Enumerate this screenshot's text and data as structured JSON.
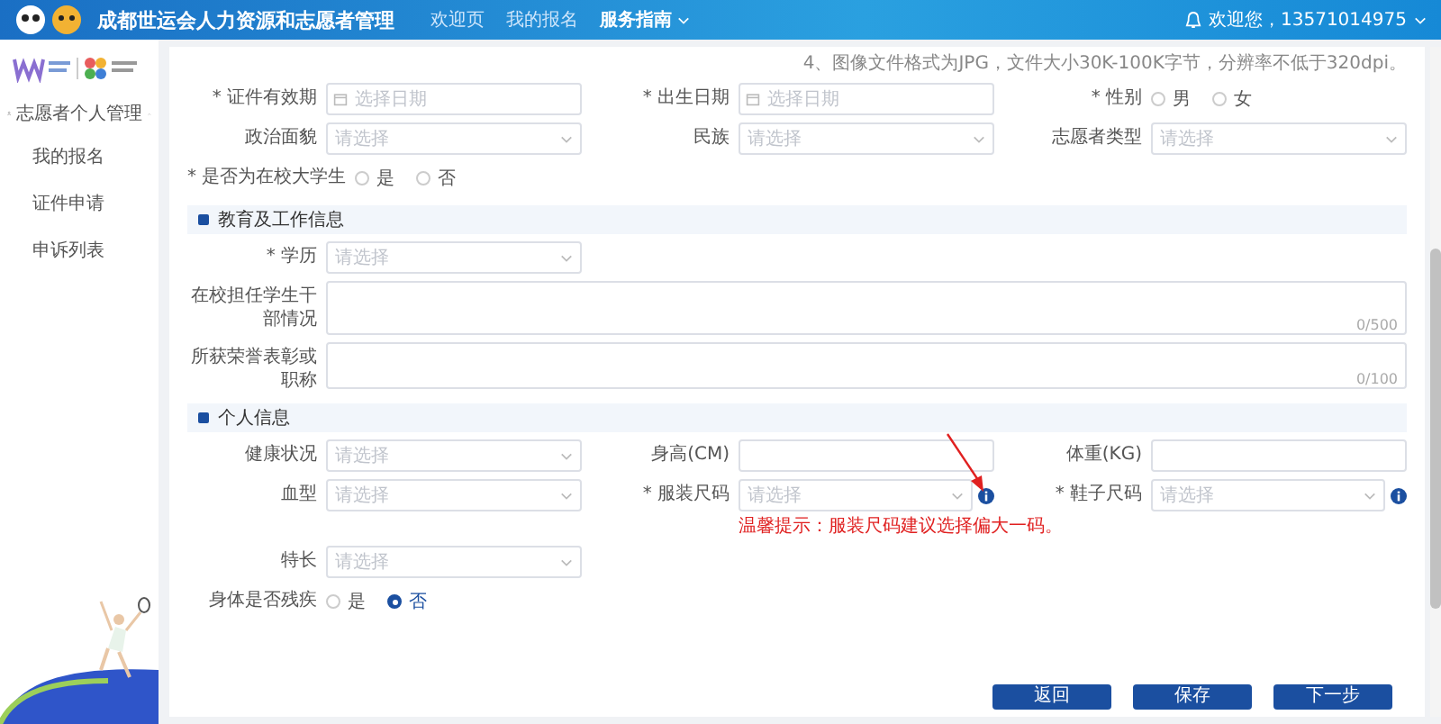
{
  "header": {
    "title": "成都世运会人力资源和志愿者管理",
    "nav": [
      {
        "label": "欢迎页",
        "selected": false
      },
      {
        "label": "我的报名",
        "selected": false
      },
      {
        "label": "服务指南",
        "selected": true
      }
    ],
    "user": "欢迎您，13571014975"
  },
  "sidebar": {
    "groups": [
      {
        "label": "志愿者个人管理",
        "expanded": true,
        "children": [
          {
            "label": "我的报名"
          },
          {
            "label": "证件申请"
          },
          {
            "label": "申诉列表"
          }
        ]
      }
    ]
  },
  "form": {
    "hint": "4、图像文件格式为JPG，文件大小30K-100K字节，分辨率不低于320dpi。",
    "blocks": [
      {
        "kind": "row",
        "fields": [
          {
            "kind": "date",
            "label": "* 证件有效期",
            "placeholder": "选择日期"
          },
          {
            "kind": "date",
            "label": "* 出生日期",
            "placeholder": "选择日期"
          },
          {
            "kind": "radio",
            "label": "* 性别",
            "options": [
              {
                "label": "男",
                "selected": false
              },
              {
                "label": "女",
                "selected": false
              }
            ]
          }
        ]
      },
      {
        "kind": "row",
        "fields": [
          {
            "kind": "select",
            "label": "政治面貌",
            "placeholder": "请选择"
          },
          {
            "kind": "select",
            "label": "民族",
            "placeholder": "请选择"
          },
          {
            "kind": "select",
            "label": "志愿者类型",
            "placeholder": "请选择"
          }
        ]
      },
      {
        "kind": "row",
        "fields": [
          {
            "kind": "radio",
            "label": "* 是否为在校大学生",
            "options": [
              {
                "label": "是",
                "selected": false
              },
              {
                "label": "否",
                "selected": false
              }
            ]
          }
        ]
      },
      {
        "kind": "section",
        "title": "教育及工作信息"
      },
      {
        "kind": "row",
        "fields": [
          {
            "kind": "select",
            "label": "* 学历",
            "placeholder": "请选择"
          }
        ]
      },
      {
        "kind": "row",
        "fields": [
          {
            "kind": "textarea",
            "label": "在校担任学生干部情况",
            "counter": "0/500",
            "tall": true
          }
        ]
      },
      {
        "kind": "row",
        "fields": [
          {
            "kind": "textarea",
            "label": "所获荣誉表彰或职称",
            "counter": "0/100",
            "tall": false
          }
        ]
      },
      {
        "kind": "section",
        "title": "个人信息"
      },
      {
        "kind": "row",
        "fields": [
          {
            "kind": "select",
            "label": "健康状况",
            "placeholder": "请选择"
          },
          {
            "kind": "input",
            "label": "身高(CM)"
          },
          {
            "kind": "input",
            "label": "体重(KG)"
          }
        ]
      },
      {
        "kind": "row",
        "fields": [
          {
            "kind": "select",
            "label": "血型",
            "placeholder": "请选择"
          },
          {
            "kind": "select",
            "label": "* 服装尺码",
            "placeholder": "请选择",
            "info": true,
            "arrow": true,
            "warning": "温馨提示：服装尺码建议选择偏大一码。"
          },
          {
            "kind": "select",
            "label": "* 鞋子尺码",
            "placeholder": "请选择",
            "info": true
          }
        ]
      },
      {
        "kind": "row",
        "fields": [
          {
            "kind": "select",
            "label": "特长",
            "placeholder": "请选择"
          }
        ]
      },
      {
        "kind": "row",
        "fields": [
          {
            "kind": "radio",
            "label": "身体是否残疾",
            "options": [
              {
                "label": "是",
                "selected": false
              },
              {
                "label": "否",
                "selected": true
              }
            ]
          }
        ]
      }
    ]
  },
  "buttons": [
    "返回",
    "保存",
    "下一步"
  ]
}
